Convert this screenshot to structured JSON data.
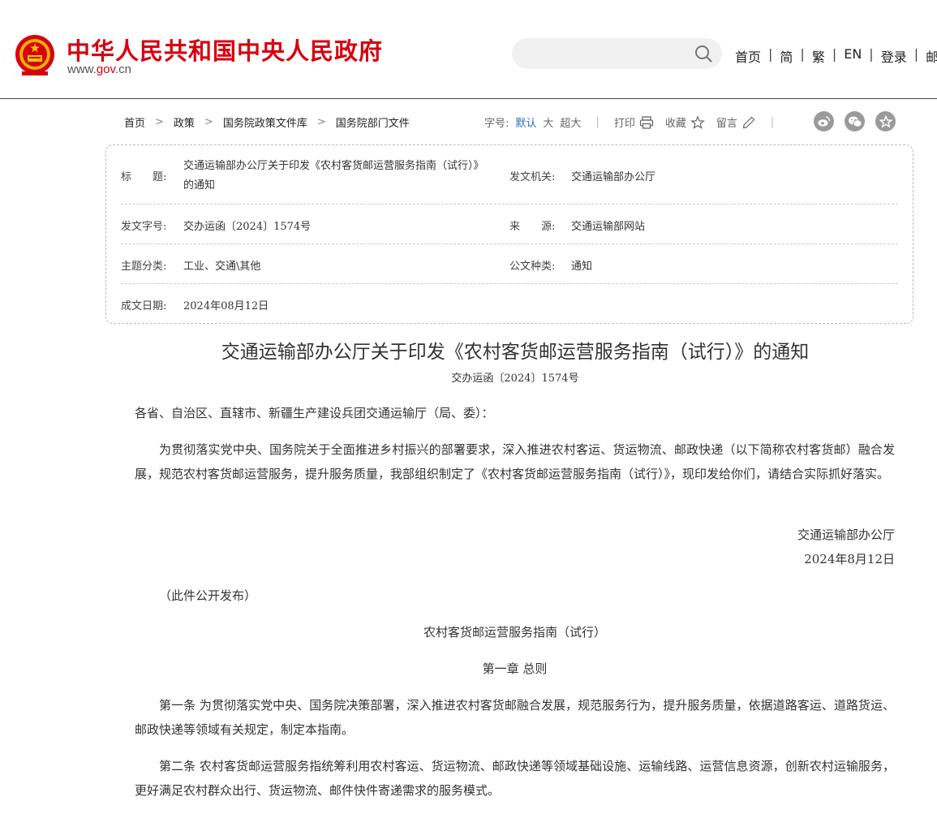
{
  "header": {
    "site_title": "中华人民共和国中央人民政府",
    "site_url_prefix": "www.",
    "site_url_domain": "gov",
    "site_url_suffix": ".cn",
    "search_placeholder": "",
    "nav": [
      "首页",
      "简",
      "繁",
      "EN",
      "登录",
      "邮箱"
    ]
  },
  "breadcrumb": [
    "首页",
    "政策",
    "国务院政策文件库",
    "国务院部门文件"
  ],
  "tools": {
    "font_label": "字号:",
    "font_default": "默认",
    "font_large": "大",
    "font_xlarge": "超大",
    "print": "打印",
    "favorite": "收藏",
    "comment": "留言"
  },
  "info": {
    "title_label": "标　　题:",
    "title_value": "交通运输部办公厅关于印发《农村客货邮运营服务指南（试行）》的通知",
    "issuer_label": "发文机关:",
    "issuer_value": "交通运输部办公厅",
    "docno_label": "发文字号:",
    "docno_value": "交办运函〔2024〕1574号",
    "source_label": "来　　源:",
    "source_value": "交通运输部网站",
    "topic_label": "主题分类:",
    "topic_value": "工业、交通\\其他",
    "type_label": "公文种类:",
    "type_value": "通知",
    "date_label": "成文日期:",
    "date_value": "2024年08月12日"
  },
  "article": {
    "title": "交通运输部办公厅关于印发《农村客货邮运营服务指南（试行）》的通知",
    "doc_no": "交办运函〔2024〕1574号",
    "salutation": "各省、自治区、直辖市、新疆生产建设兵团交通运输厅（局、委）：",
    "body": "为贯彻落实党中央、国务院关于全面推进乡村振兴的部署要求，深入推进农村客运、货运物流、邮政快递（以下简称农村客货邮）融合发展，规范农村客货邮运营服务，提升服务质量，我部组织制定了《农村客货邮运营服务指南（试行）》，现印发给你们，请结合实际抓好落实。",
    "signer": "交通运输部办公厅",
    "sign_date": "2024年8月12日",
    "note": "（此件公开发布）",
    "guide_title": "农村客货邮运营服务指南（试行）",
    "chapter1": "第一章  总则",
    "art1": "第一条  为贯彻落实党中央、国务院决策部署，深入推进农村客货邮融合发展，规范服务行为，提升服务质量，依据道路客运、道路货运、邮政快递等领域有关规定，制定本指南。",
    "art2": "第二条  农村客货邮运营服务指统筹利用农村客运、货运物流、邮政快递等领域基础设施、运输线路、运营信息资源，创新农村运输服务，更好满足农村群众出行、货运物流、邮件快件寄递需求的服务模式。"
  }
}
